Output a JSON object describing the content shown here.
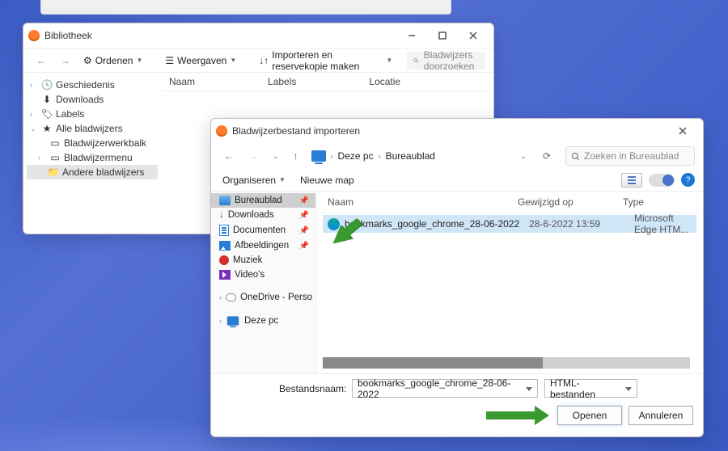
{
  "library": {
    "title": "Bibliotheek",
    "toolbar": {
      "organize": "Ordenen",
      "views": "Weergaven",
      "import": "Importeren en reservekopie maken",
      "search_placeholder": "Bladwijzers doorzoeken"
    },
    "tree": {
      "history": "Geschiedenis",
      "downloads": "Downloads",
      "labels": "Labels",
      "all_bookmarks": "Alle bladwijzers",
      "toolbar_folder": "Bladwijzerwerkbalk",
      "menu_folder": "Bladwijzermenu",
      "other_folder": "Andere bladwijzers"
    },
    "columns": {
      "name": "Naam",
      "labels": "Labels",
      "location": "Locatie"
    }
  },
  "dialog": {
    "title": "Bladwijzerbestand importeren",
    "breadcrumb": {
      "root": "Deze pc",
      "folder": "Bureaublad"
    },
    "search_placeholder": "Zoeken in Bureaublad",
    "toolbar": {
      "organize": "Organiseren",
      "new_folder": "Nieuwe map"
    },
    "tree": {
      "desktop": "Bureaublad",
      "downloads": "Downloads",
      "documents": "Documenten",
      "pictures": "Afbeeldingen",
      "music": "Muziek",
      "videos": "Video's",
      "onedrive": "OneDrive - Perso",
      "thispc": "Deze pc"
    },
    "columns": {
      "name": "Naam",
      "modified": "Gewijzigd op",
      "type": "Type"
    },
    "file": {
      "name": "bookmarks_google_chrome_28-06-2022",
      "date": "28-6-2022 13:59",
      "type": "Microsoft Edge HTM..."
    },
    "footer": {
      "filename_label": "Bestandsnaam:",
      "filename_value": "bookmarks_google_chrome_28-06-2022",
      "filetype": "HTML-bestanden",
      "open": "Openen",
      "cancel": "Annuleren"
    }
  }
}
